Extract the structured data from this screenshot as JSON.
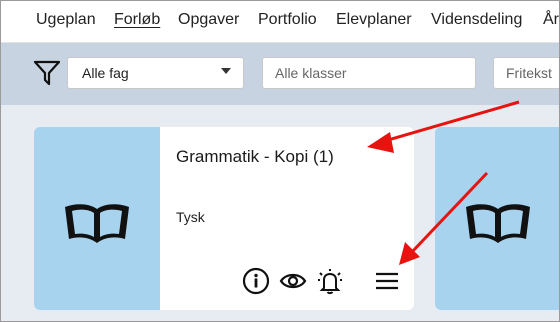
{
  "nav": {
    "items": [
      {
        "label": "Ugeplan",
        "active": false
      },
      {
        "label": "Forløb",
        "active": true
      },
      {
        "label": "Opgaver",
        "active": false
      },
      {
        "label": "Portfolio",
        "active": false
      },
      {
        "label": "Elevplaner",
        "active": false
      },
      {
        "label": "Vidensdeling",
        "active": false
      },
      {
        "label": "År",
        "active": false
      }
    ]
  },
  "filters": {
    "subject_select": "Alle fag",
    "classes_placeholder": "Alle klasser",
    "freetext_placeholder": "Fritekst"
  },
  "cards": [
    {
      "title": "Grammatik - Kopi (1)",
      "subject": "Tysk"
    }
  ],
  "colors": {
    "thumb_bg": "#a7d3ef",
    "filterbar_bg": "#c7d3e0",
    "annotation_arrow": "#e8130f"
  }
}
